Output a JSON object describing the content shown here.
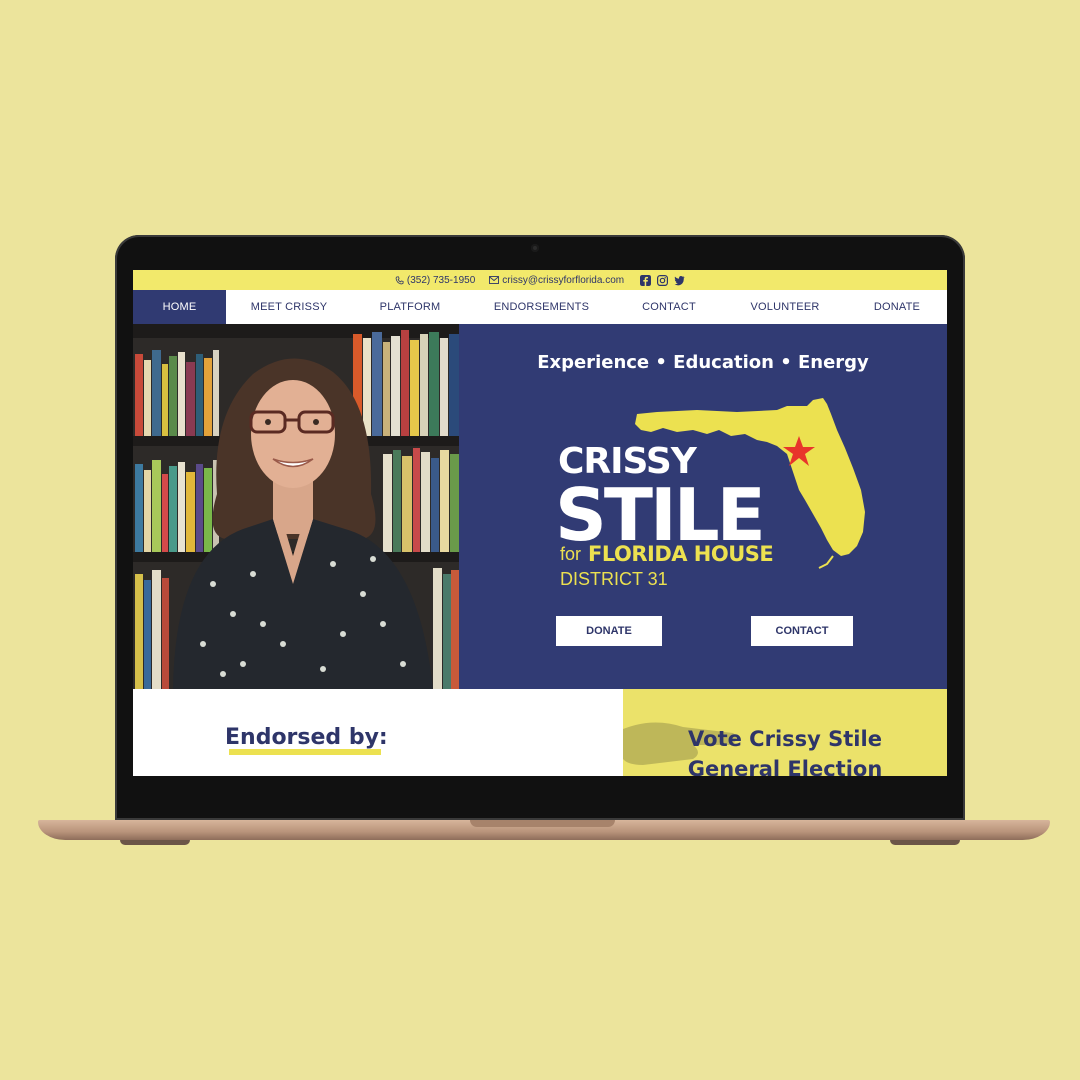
{
  "topbar": {
    "phone": "(352) 735-1950",
    "email": "crissy@crissyforflorida.com",
    "socials": [
      "facebook-icon",
      "instagram-icon",
      "twitter-icon"
    ]
  },
  "nav": {
    "items": [
      {
        "label": "HOME",
        "active": true
      },
      {
        "label": "MEET CRISSY",
        "active": false
      },
      {
        "label": "PLATFORM",
        "active": false
      },
      {
        "label": "ENDORSEMENTS",
        "active": false
      },
      {
        "label": "CONTACT",
        "active": false
      },
      {
        "label": "VOLUNTEER",
        "active": false
      },
      {
        "label": "DONATE",
        "active": false
      }
    ]
  },
  "hero": {
    "tagline": "Experience • Education • Energy",
    "logo": {
      "first_name": "CRISSY",
      "last_name": "STILE",
      "for": "for",
      "office": "FLORIDA HOUSE",
      "district": "DISTRICT 31"
    },
    "donate_label": "DONATE",
    "contact_label": "CONTACT"
  },
  "endorsed": {
    "title": "Endorsed by:"
  },
  "vote": {
    "line1": "Vote Crissy Stile",
    "line2": "General Election"
  },
  "colors": {
    "navy": "#313b74",
    "yellow": "#ece150",
    "background": "#ece49c",
    "star": "#e8352b"
  }
}
